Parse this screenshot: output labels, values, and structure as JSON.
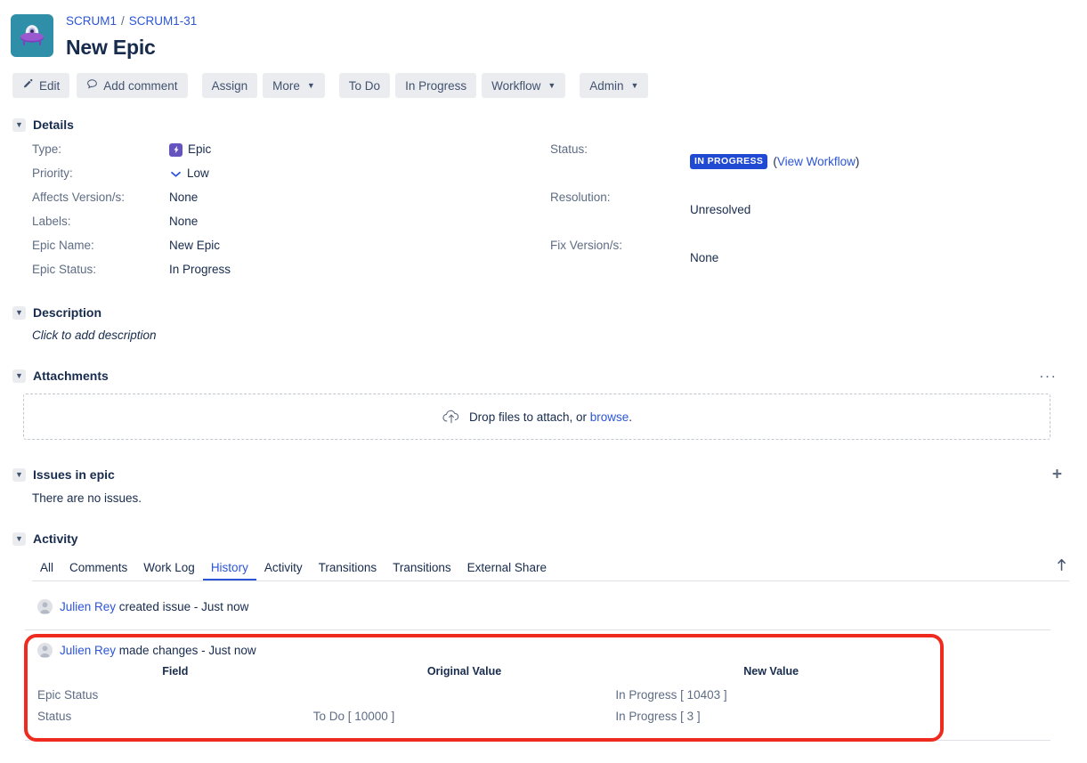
{
  "header": {
    "avatar_icon": "ufo-avatar",
    "breadcrumb": {
      "project": "SCRUM1",
      "separator": "/",
      "issue_key": "SCRUM1-31"
    },
    "title": "New Epic"
  },
  "toolbar": {
    "edit": "Edit",
    "add_comment": "Add comment",
    "assign": "Assign",
    "more": "More",
    "to_do": "To Do",
    "in_progress": "In Progress",
    "workflow": "Workflow",
    "admin": "Admin"
  },
  "details": {
    "title": "Details",
    "left": [
      {
        "label": "Type:",
        "value": "Epic",
        "icon": "epic-icon"
      },
      {
        "label": "Priority:",
        "value": "Low",
        "icon": "priority-low-icon"
      },
      {
        "label": "Affects Version/s:",
        "value": "None",
        "icon": ""
      },
      {
        "label": "Labels:",
        "value": "None",
        "icon": ""
      },
      {
        "label": "Epic Name:",
        "value": "New Epic",
        "icon": ""
      },
      {
        "label": "Epic Status:",
        "value": "In Progress",
        "icon": ""
      }
    ],
    "right": [
      {
        "label": "Status:",
        "value": "IN PROGRESS",
        "link": "View Workflow"
      },
      {
        "label": "Resolution:",
        "value": "Unresolved",
        "link": ""
      },
      {
        "label": "Fix Version/s:",
        "value": "None",
        "link": ""
      }
    ]
  },
  "description": {
    "title": "Description",
    "placeholder": "Click to add description"
  },
  "attachments": {
    "title": "Attachments",
    "more_options": "···",
    "drop_text": "Drop files to attach, or ",
    "browse_label": "browse",
    "drop_text_end": "."
  },
  "issues_in_epic": {
    "title": "Issues in epic",
    "add_label": "+",
    "empty_text": "There are no issues."
  },
  "activity": {
    "title": "Activity",
    "tabs": [
      {
        "label": "All",
        "active": false
      },
      {
        "label": "Comments",
        "active": false
      },
      {
        "label": "Work Log",
        "active": false
      },
      {
        "label": "History",
        "active": true
      },
      {
        "label": "Activity",
        "active": false
      },
      {
        "label": "Transitions",
        "active": false
      },
      {
        "label": "Transitions",
        "active": false
      },
      {
        "label": "External Share",
        "active": false
      }
    ],
    "sort_icon": "sort-ascending-icon",
    "entries": [
      {
        "user": "Julien Rey",
        "action": "created issue",
        "time": "Just now"
      },
      {
        "user": "Julien Rey",
        "action": "made changes",
        "time": "Just now"
      }
    ],
    "changes_table": {
      "headers": [
        "Field",
        "Original Value",
        "New Value"
      ],
      "rows": [
        {
          "field": "Epic Status",
          "original": "",
          "new": "In Progress [ 10403 ]"
        },
        {
          "field": "Status",
          "original": "To Do [ 10000 ]",
          "new": "In Progress [ 3 ]"
        }
      ]
    }
  },
  "colors": {
    "link": "#2b55d6",
    "status_badge": "#2049d4",
    "epic_purple": "#6554C0",
    "annotation_red": "#ef2b1f",
    "avatar_bg": "#2f8fa8"
  }
}
